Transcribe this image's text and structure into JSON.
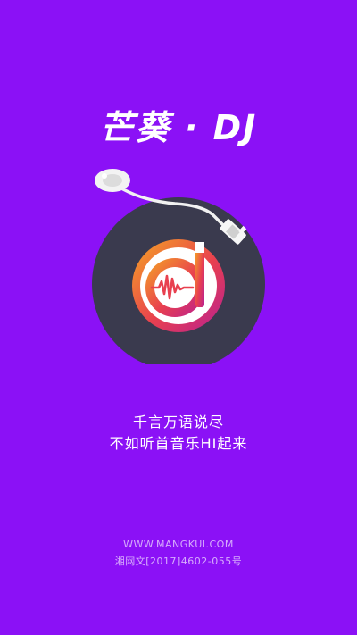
{
  "app": {
    "title": "芒葵 · DJ"
  },
  "tagline": {
    "line1": "千言万语说尽",
    "line2": "不如听首音乐HI起来"
  },
  "footer": {
    "website": "WWW.MANGKUI.COM",
    "license": "湘网文[2017]4602-055号"
  },
  "colors": {
    "background": "#8b11f6",
    "record": "#3a3a4e",
    "accent_gradient_start": "#f2a12e",
    "accent_gradient_end": "#c0208f"
  },
  "icons": {
    "logo": "dj-record-logo-icon",
    "tonearm": "tonearm-icon"
  }
}
